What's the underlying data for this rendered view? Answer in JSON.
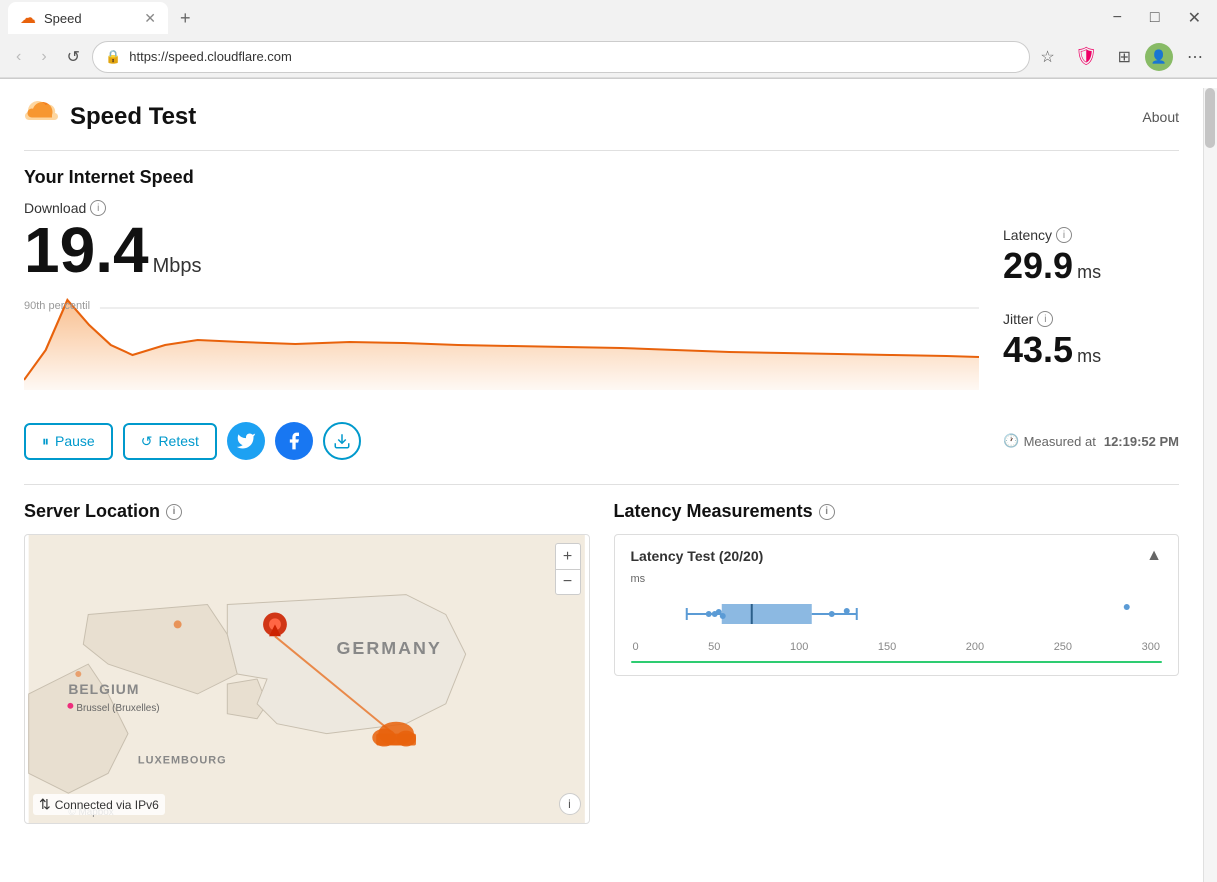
{
  "browser": {
    "tab_title": "Speed",
    "tab_icon": "☁",
    "url": "https://speed.cloudflare.com",
    "new_tab_label": "+",
    "win_minimize": "−",
    "win_maximize": "□",
    "win_close": "✕"
  },
  "nav": {
    "back_label": "‹",
    "forward_label": "›",
    "refresh_label": "↺",
    "lock_icon": "🔒",
    "star_icon": "☆",
    "menu_icon": "⋯"
  },
  "header": {
    "logo_icon": "✈",
    "title": "Speed Test",
    "about_label": "About"
  },
  "speed": {
    "section_title": "Your Internet Speed",
    "download_label": "Download",
    "download_value": "19.4",
    "download_unit": "Mbps",
    "latency_label": "Latency",
    "latency_value": "29.9",
    "latency_unit": "ms",
    "jitter_label": "Jitter",
    "jitter_value": "43.5",
    "jitter_unit": "ms",
    "chart_label_90th": "90th percentil"
  },
  "actions": {
    "pause_label": "Pause",
    "retest_label": "Retest",
    "measured_at_label": "Measured at",
    "measured_time": "12:19:52 PM"
  },
  "server_location": {
    "title": "Server Location",
    "connected_label": "Connected via IPv6",
    "zoom_in": "+",
    "zoom_out": "−",
    "countries": [
      "GERMANY",
      "BELGIUM",
      "LUXEMBOURG"
    ],
    "cities": [
      "Brussel (Bruxelles)"
    ]
  },
  "latency_measurements": {
    "title": "Latency Measurements",
    "chart_title": "Latency Test (20/20)",
    "axis_label": "ms",
    "axis_values": [
      "0",
      "50",
      "100",
      "150",
      "200",
      "250",
      "300"
    ],
    "box_start": 660,
    "box_end": 760,
    "line_end": 840,
    "dots": [
      680,
      690,
      695,
      700,
      705,
      760,
      795,
      830,
      1140
    ]
  }
}
